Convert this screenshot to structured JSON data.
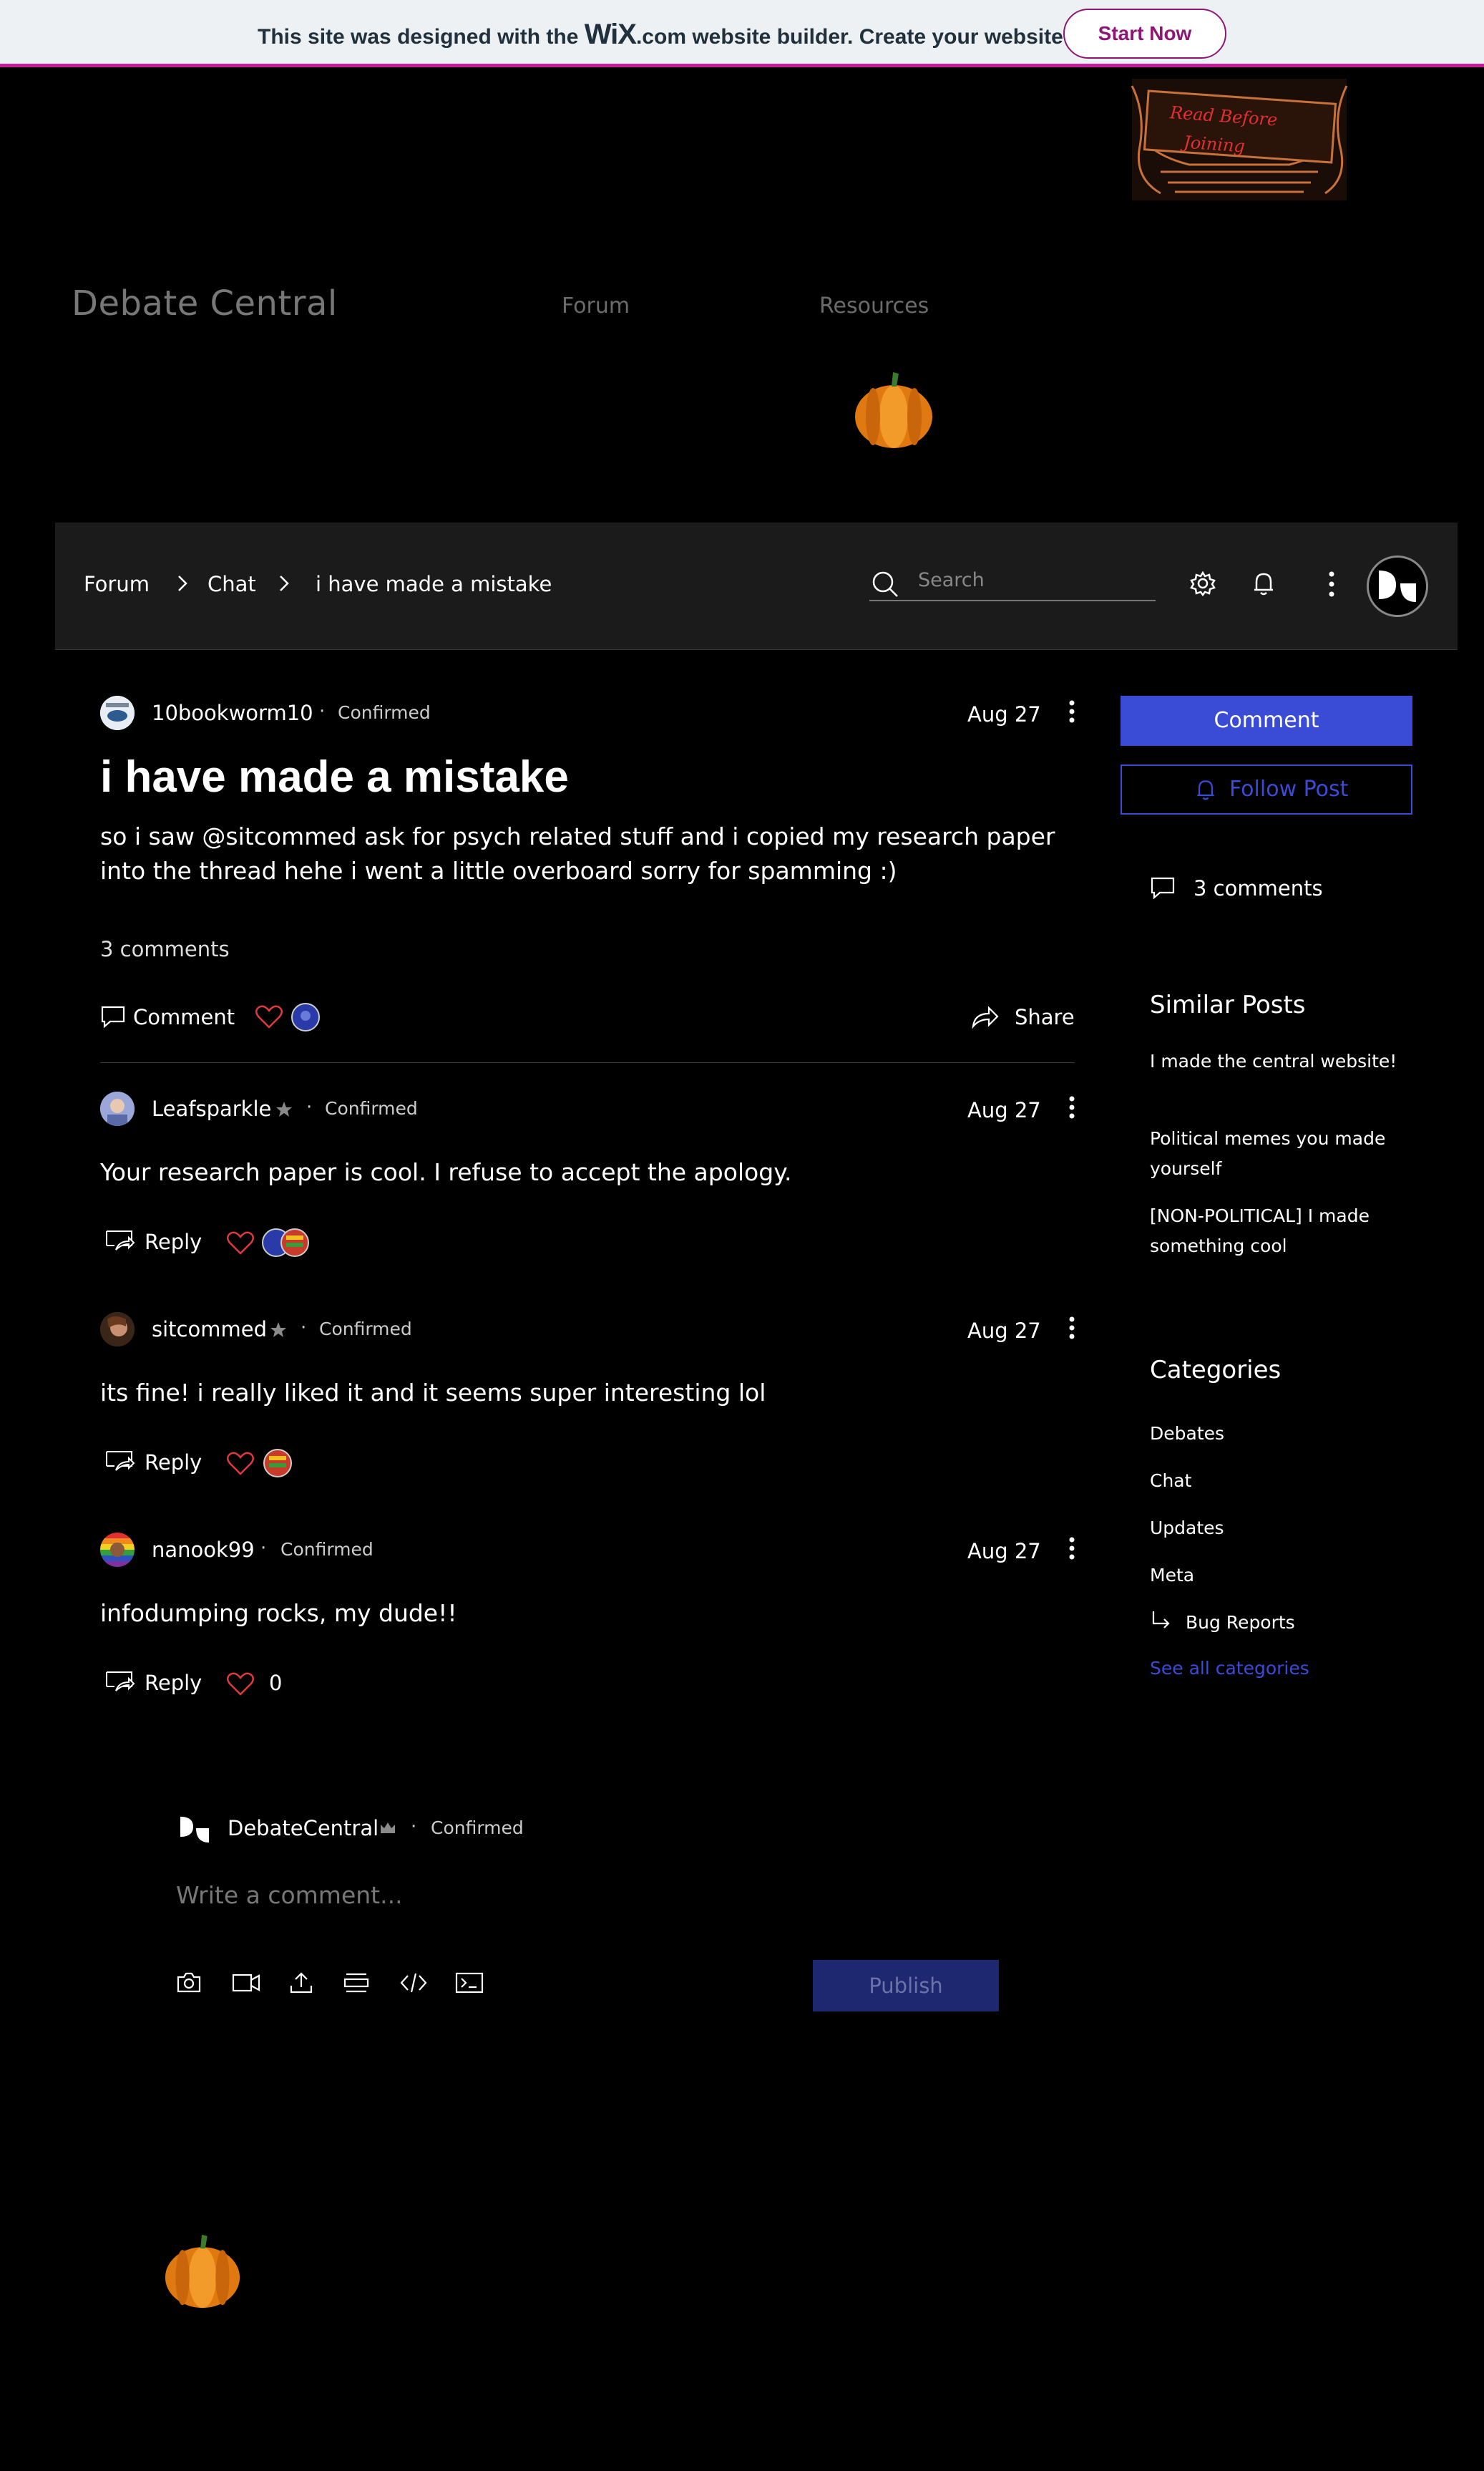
{
  "banner": {
    "text_before": "This site was designed with the ",
    "logo": "WiX",
    "text_after": ".com website builder. Create your website today.",
    "start_label": "Start Now"
  },
  "header": {
    "site_title": "Debate Central",
    "nav": [
      "Forum",
      "Resources"
    ],
    "sign_text": [
      "Read Before",
      "Joining"
    ]
  },
  "breadcrumb": [
    "Forum",
    "Chat",
    "i have made a mistake"
  ],
  "search": {
    "placeholder": "Search"
  },
  "post": {
    "author": "10bookworm10",
    "badge": "Confirmed",
    "date": "Aug 27",
    "title": "i have made a mistake",
    "body": "so i saw @sitcommed ask for psych related stuff and i copied my research paper into the thread hehe i went a little overboard sorry for spamming :)",
    "comments_count": "3 comments",
    "comment_label": "Comment",
    "share_label": "Share"
  },
  "comments": [
    {
      "author": "Leafsparkle",
      "badge": "Confirmed",
      "date": "Aug 27",
      "text": "Your research paper is cool. I refuse to accept the apology.",
      "reply_label": "Reply"
    },
    {
      "author": "sitcommed",
      "badge": "Confirmed",
      "date": "Aug 27",
      "text": "its fine! i really liked it and it seems super interesting lol",
      "reply_label": "Reply"
    },
    {
      "author": "nanook99",
      "badge": "Confirmed",
      "date": "Aug 27",
      "text": "infodumping rocks, my dude!!",
      "reply_label": "Reply",
      "likes": "0"
    }
  ],
  "sidebar": {
    "comment_button": "Comment",
    "follow_button": "Follow Post",
    "comments_count": "3 comments",
    "similar_title": "Similar Posts",
    "similar_posts": [
      "I made the central website!",
      "Political memes you made yourself",
      "[NON-POLITICAL] I made something cool"
    ],
    "categories_title": "Categories",
    "categories": [
      "Debates",
      "Chat",
      "Updates",
      "Meta",
      "Bug Reports"
    ],
    "see_all": "See all categories"
  },
  "composer": {
    "author": "DebateCentral",
    "badge": "Confirmed",
    "placeholder": "Write a comment...",
    "publish_label": "Publish"
  },
  "colors": {
    "accent": "#3a4bd6",
    "wix_pink": "#c81c9e",
    "heart": "#e0393e"
  }
}
